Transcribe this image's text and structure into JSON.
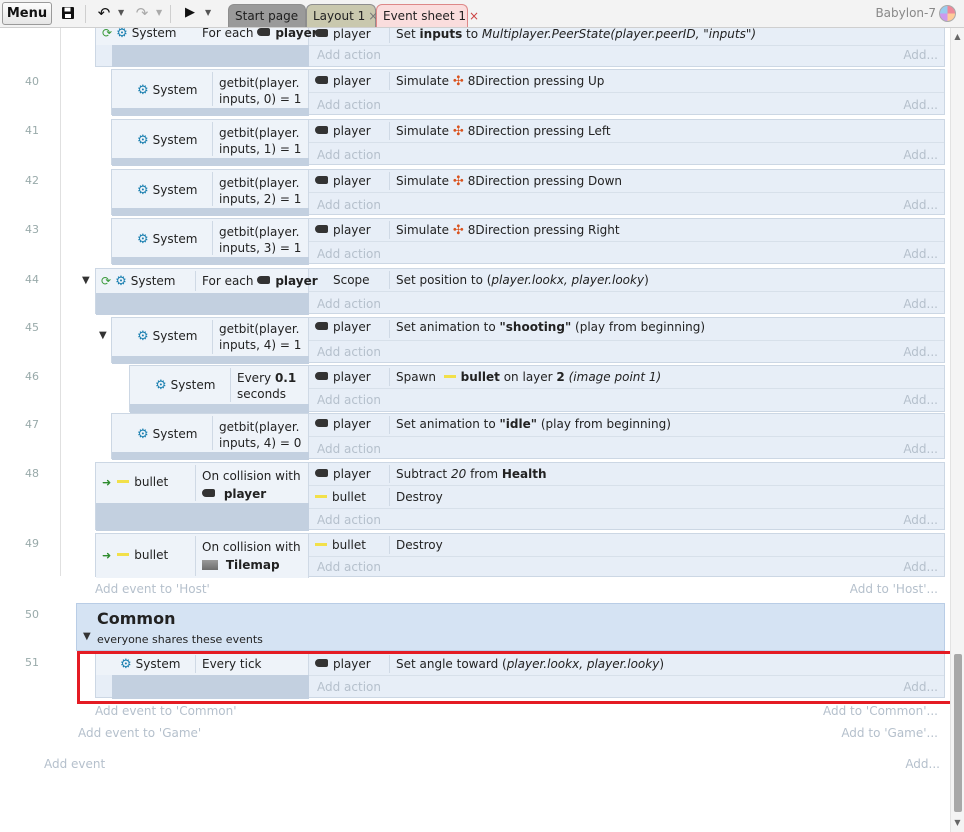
{
  "toolbar": {
    "menu_label": "Menu",
    "tabs": [
      {
        "label": "Start page"
      },
      {
        "label": "Layout 1"
      },
      {
        "label": "Event sheet 1",
        "close": "×"
      }
    ],
    "project_name": "Babylon-7"
  },
  "events": {
    "e39": {
      "condition_object": "System",
      "condition_text_pre": "For each",
      "condition_obj": "player",
      "action_object": "player",
      "action_pre": "Set",
      "action_bold": "inputs",
      "action_mid": " to ",
      "action_italic": "Multiplayer.PeerState(player.peerID, \"inputs\")",
      "add_action": "Add action",
      "add_dots": "Add..."
    },
    "e40": {
      "line": "40",
      "condition_object": "System",
      "cond_line1": "getbit(player.",
      "cond_line2": "inputs, 0) = 1",
      "action_object": "player",
      "action_pre": "Simulate",
      "action_icon": "8Direction",
      "action_post": "pressing Up",
      "add_action": "Add action",
      "add_dots": "Add..."
    },
    "e41": {
      "line": "41",
      "condition_object": "System",
      "cond_line1": "getbit(player.",
      "cond_line2": "inputs, 1) = 1",
      "action_object": "player",
      "action_pre": "Simulate",
      "action_icon": "8Direction",
      "action_post": "pressing Left",
      "add_action": "Add action",
      "add_dots": "Add..."
    },
    "e42": {
      "line": "42",
      "condition_object": "System",
      "cond_line1": "getbit(player.",
      "cond_line2": "inputs, 2) = 1",
      "action_object": "player",
      "action_pre": "Simulate",
      "action_icon": "8Direction",
      "action_post": "pressing Down",
      "add_action": "Add action",
      "add_dots": "Add..."
    },
    "e43": {
      "line": "43",
      "condition_object": "System",
      "cond_line1": "getbit(player.",
      "cond_line2": "inputs, 3) = 1",
      "action_object": "player",
      "action_pre": "Simulate",
      "action_icon": "8Direction",
      "action_post": "pressing Right",
      "add_action": "Add action",
      "add_dots": "Add..."
    },
    "e44": {
      "line": "44",
      "condition_object": "System",
      "condition_text_pre": "For each",
      "condition_obj": "player",
      "action_object": "Scope",
      "action_pre": "Set position to (",
      "action_italic": "player.lookx, player.looky",
      "action_post": ")",
      "add_action": "Add action",
      "add_dots": "Add..."
    },
    "e45": {
      "line": "45",
      "condition_object": "System",
      "cond_line1": "getbit(player.",
      "cond_line2": "inputs, 4) = 1",
      "action_object": "player",
      "action_pre": "Set animation to",
      "action_bold": "\"shooting\"",
      "action_post": "(play from beginning)",
      "add_action": "Add action",
      "add_dots": "Add..."
    },
    "e46": {
      "line": "46",
      "condition_object": "System",
      "cond_pre": "Every",
      "cond_bold": "0.1",
      "cond_line2": "seconds",
      "action_object": "player",
      "action_pre": "Spawn",
      "action_bold": "bullet",
      "action_mid": "on layer",
      "action_bold2": "2",
      "action_italic": "(image point 1)",
      "add_action": "Add action",
      "add_dots": "Add..."
    },
    "e47": {
      "line": "47",
      "condition_object": "System",
      "cond_line1": "getbit(player.",
      "cond_line2": "inputs, 4) = 0",
      "action_object": "player",
      "action_pre": "Set animation to",
      "action_bold": "\"idle\"",
      "action_post": "(play from beginning)",
      "add_action": "Add action",
      "add_dots": "Add..."
    },
    "e48": {
      "line": "48",
      "condition_object": "bullet",
      "cond_line1": "On collision with",
      "cond_obj": "player",
      "action1_object": "player",
      "action1_pre": "Subtract",
      "action1_italic": "20",
      "action1_mid": "from",
      "action1_bold": "Health",
      "action2_object": "bullet",
      "action2_text": "Destroy",
      "add_action": "Add action",
      "add_dots": "Add..."
    },
    "e49": {
      "line": "49",
      "condition_object": "bullet",
      "cond_line1": "On collision with",
      "cond_obj": "Tilemap",
      "action_object": "bullet",
      "action_text": "Destroy",
      "add_action": "Add action",
      "add_dots": "Add..."
    },
    "e51": {
      "line": "51",
      "condition_object": "System",
      "condition_text": "Every tick",
      "action_object": "player",
      "action_pre": "Set angle toward (",
      "action_italic": "player.lookx, player.looky",
      "action_post": ")",
      "add_action": "Add action",
      "add_dots": "Add..."
    }
  },
  "group_common": {
    "line": "50",
    "title": "Common",
    "description": "everyone shares these events"
  },
  "links": {
    "add_event_host": "Add event to 'Host'",
    "add_to_host": "Add to 'Host'...",
    "add_event_common": "Add event to 'Common'",
    "add_to_common": "Add to 'Common'...",
    "add_event_game": "Add event to 'Game'",
    "add_to_game": "Add to 'Game'...",
    "add_event": "Add event",
    "add": "Add..."
  }
}
